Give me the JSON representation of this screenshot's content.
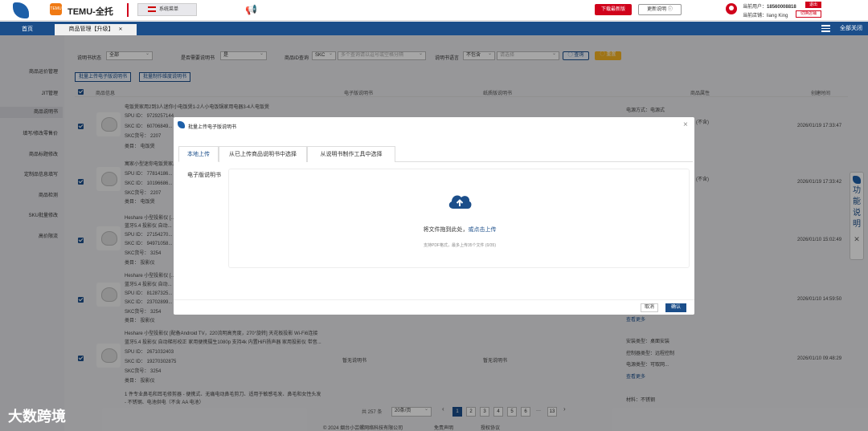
{
  "header": {
    "brand": "TEMU-全托",
    "badge": "TEMU",
    "system_menu": "系统菜单",
    "download_btn": "下载最新版",
    "update_btn": "更新说明 ⓘ",
    "user_label": "当前用户：",
    "user_value": "18560008818",
    "shop_label": "当前店铺：",
    "shop_value": "liang King",
    "logout": "退出",
    "switch_shop": "切换店铺"
  },
  "tabs": {
    "home": "首页",
    "active": "商品管理【升级】",
    "close_all": "全部关闭"
  },
  "sidebar": {
    "items": [
      "商品运价管理",
      "JIT管理",
      "商品说明书",
      "填写/修改零售价",
      "商品标题修改",
      "定制品信息填写",
      "商品检测",
      "SKU批量修改",
      "高价限流"
    ]
  },
  "filters": {
    "manual_status_label": "说明书状态",
    "manual_status_value": "全部",
    "needs_manual_label": "是否需要说明书",
    "needs_manual_value": "是",
    "product_id_label": "商品ID查询",
    "product_id_type": "SKC",
    "product_id_placeholder": "多个查询请以逗号或空格分隔",
    "manual_lang_label": "说明书语言",
    "manual_lang_value": "不包含",
    "manual_lang_placeholder": "请选择",
    "query_btn": "◯ 查询",
    "reset_btn": "◯ 重置"
  },
  "actions": {
    "batch_upload": "批量上传电子版说明书",
    "batch_make": "批量制作维度说明书"
  },
  "table": {
    "headers": [
      "商品信息",
      "电子版说明书",
      "纸质版说明书",
      "商品属性",
      "创建时间"
    ],
    "rows": [
      {
        "title": "电饭煲家用2到3人迷你小电饭煲1-2人小电饭锅家用电器3-4人电饭煲",
        "spu": "SPU ID： 9729257144",
        "skc": "SKC ID： 60706849...",
        "skc_no": "SKC货号： 2207",
        "cat": "类目： 电饭煲",
        "attr": "电源方式：电源式",
        "attr2": "(不含)",
        "time": "2026/01/19 17:33:47"
      },
      {
        "title": "寓家小型迷你电饭煲家用...",
        "spu": "SPU ID： 77814186...",
        "skc": "SKC ID： 10196686...",
        "skc_no": "SKC货号： 2207",
        "cat": "类目： 电饭煲",
        "attr": "",
        "attr2": "(不含)",
        "time": "2026/01/19 17:33:42"
      },
      {
        "title": "Heshare 小型投影仪 [...",
        "spu": "蓝牙5.4 投影仪 自动...",
        "skc": "SPU ID： 27154270...",
        "skc_no": "SKC ID： 94971058...",
        "cat": "SKC货号： 3254",
        "cat2": "类目： 投影仪",
        "attr": "",
        "attr2": "",
        "time": "2026/01/10 15:02:49"
      },
      {
        "title": "Heshare 小型投影仪 [...",
        "spu": "蓝牙5.4 投影仪 自动...",
        "skc": "SPU ID： 81287325...",
        "skc_no": "SKC ID： 23702899...",
        "cat": "SKC货号： 3254",
        "cat2": "类目： 投影仪",
        "attr": "查看更多",
        "attr2": "",
        "time": "2026/01/10 14:59:50"
      },
      {
        "title": "Heshare 小型投影仪 [配备Android TV，220流明高亮度，270°旋转] 天花板投影 Wi-Fi6连接",
        "title2": "蓝牙5.4 投影仪 自动梯形校正 家用便携摄生1080p 支持4k 内置HiFi扬声器 家用投影仪 带音...",
        "spu": "SPU ID： 2671032403",
        "skc": "SKC ID： 19270302875",
        "skc_no": "SKC货号： 3254",
        "cat": "类目： 投影仪",
        "e_manual": "暂无说明书",
        "p_manual": "暂无说明书",
        "attr": "安装类型：桌面安装",
        "attr2": "控制器类型：远程控制",
        "attr3": "电源类型：可取网...",
        "attr4": "查看更多",
        "time": "2026/01/10 09:48:29"
      },
      {
        "title": "1 件专业鼻毛和耳毛修剪器 - 便携式、无痛电动鼻毛剪刀、适用于敏感毛发、鼻毛和女性头发",
        "title2": "- 不锈钢、电池供电（不含 AA 电池）",
        "attr": "材料：不锈钢"
      }
    ]
  },
  "pagination": {
    "total": "共 257 条",
    "per_page": "20条/页",
    "pages": [
      "1",
      "2",
      "3",
      "4",
      "5",
      "6",
      "···",
      "13"
    ],
    "prev": "‹",
    "next": "›"
  },
  "footer": {
    "copyright": "© 2024 烟台小芸螺网络科技有限公司",
    "disclaimer": "免责声明",
    "license": "授权协议"
  },
  "watermark": "大数跨境",
  "side_float": {
    "text": "功能说明",
    "close": "✕"
  },
  "modal": {
    "title": "批量上传电子版说明书",
    "tabs": [
      "本地上传",
      "从已上传商品说明书中选择",
      "从说明书制作工具中选择"
    ],
    "field_label": "电子版说明书",
    "drop_text": "将文件拖到此处，",
    "drop_link": "或点击上传",
    "hint": "支持PDF格式，最多上传35个文件 (0/35)",
    "cancel": "取消",
    "confirm": "确认"
  }
}
